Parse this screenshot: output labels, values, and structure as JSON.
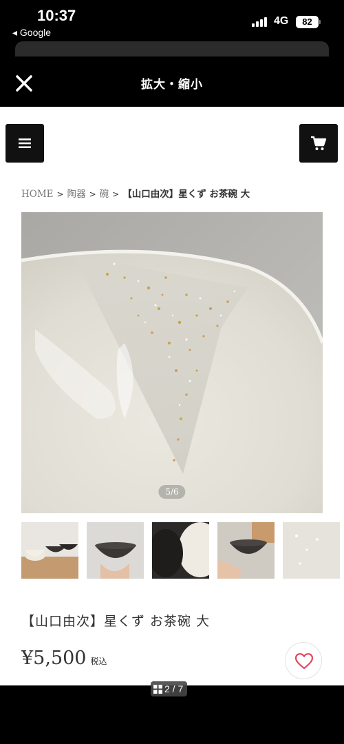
{
  "status_bar": {
    "time": "10:37",
    "back_app": "◂ Google",
    "network": "4G",
    "battery": "82"
  },
  "viewer": {
    "title": "拡大・縮小"
  },
  "breadcrumb": {
    "items": [
      "HOME",
      "陶器",
      "碗"
    ],
    "separator": ">",
    "current": "【山口由次】星くず お茶碗 大"
  },
  "gallery": {
    "counter": "5/6"
  },
  "product": {
    "title": "【山口由次】星くず お茶碗 大",
    "price": "¥5,500",
    "tax_label": "税込"
  },
  "bottom_bar": {
    "page_indicator": "2 / 7"
  },
  "colors": {
    "header_bg": "#000000",
    "button_bg": "#111111",
    "text": "#333333",
    "heart": "#e0455a"
  }
}
